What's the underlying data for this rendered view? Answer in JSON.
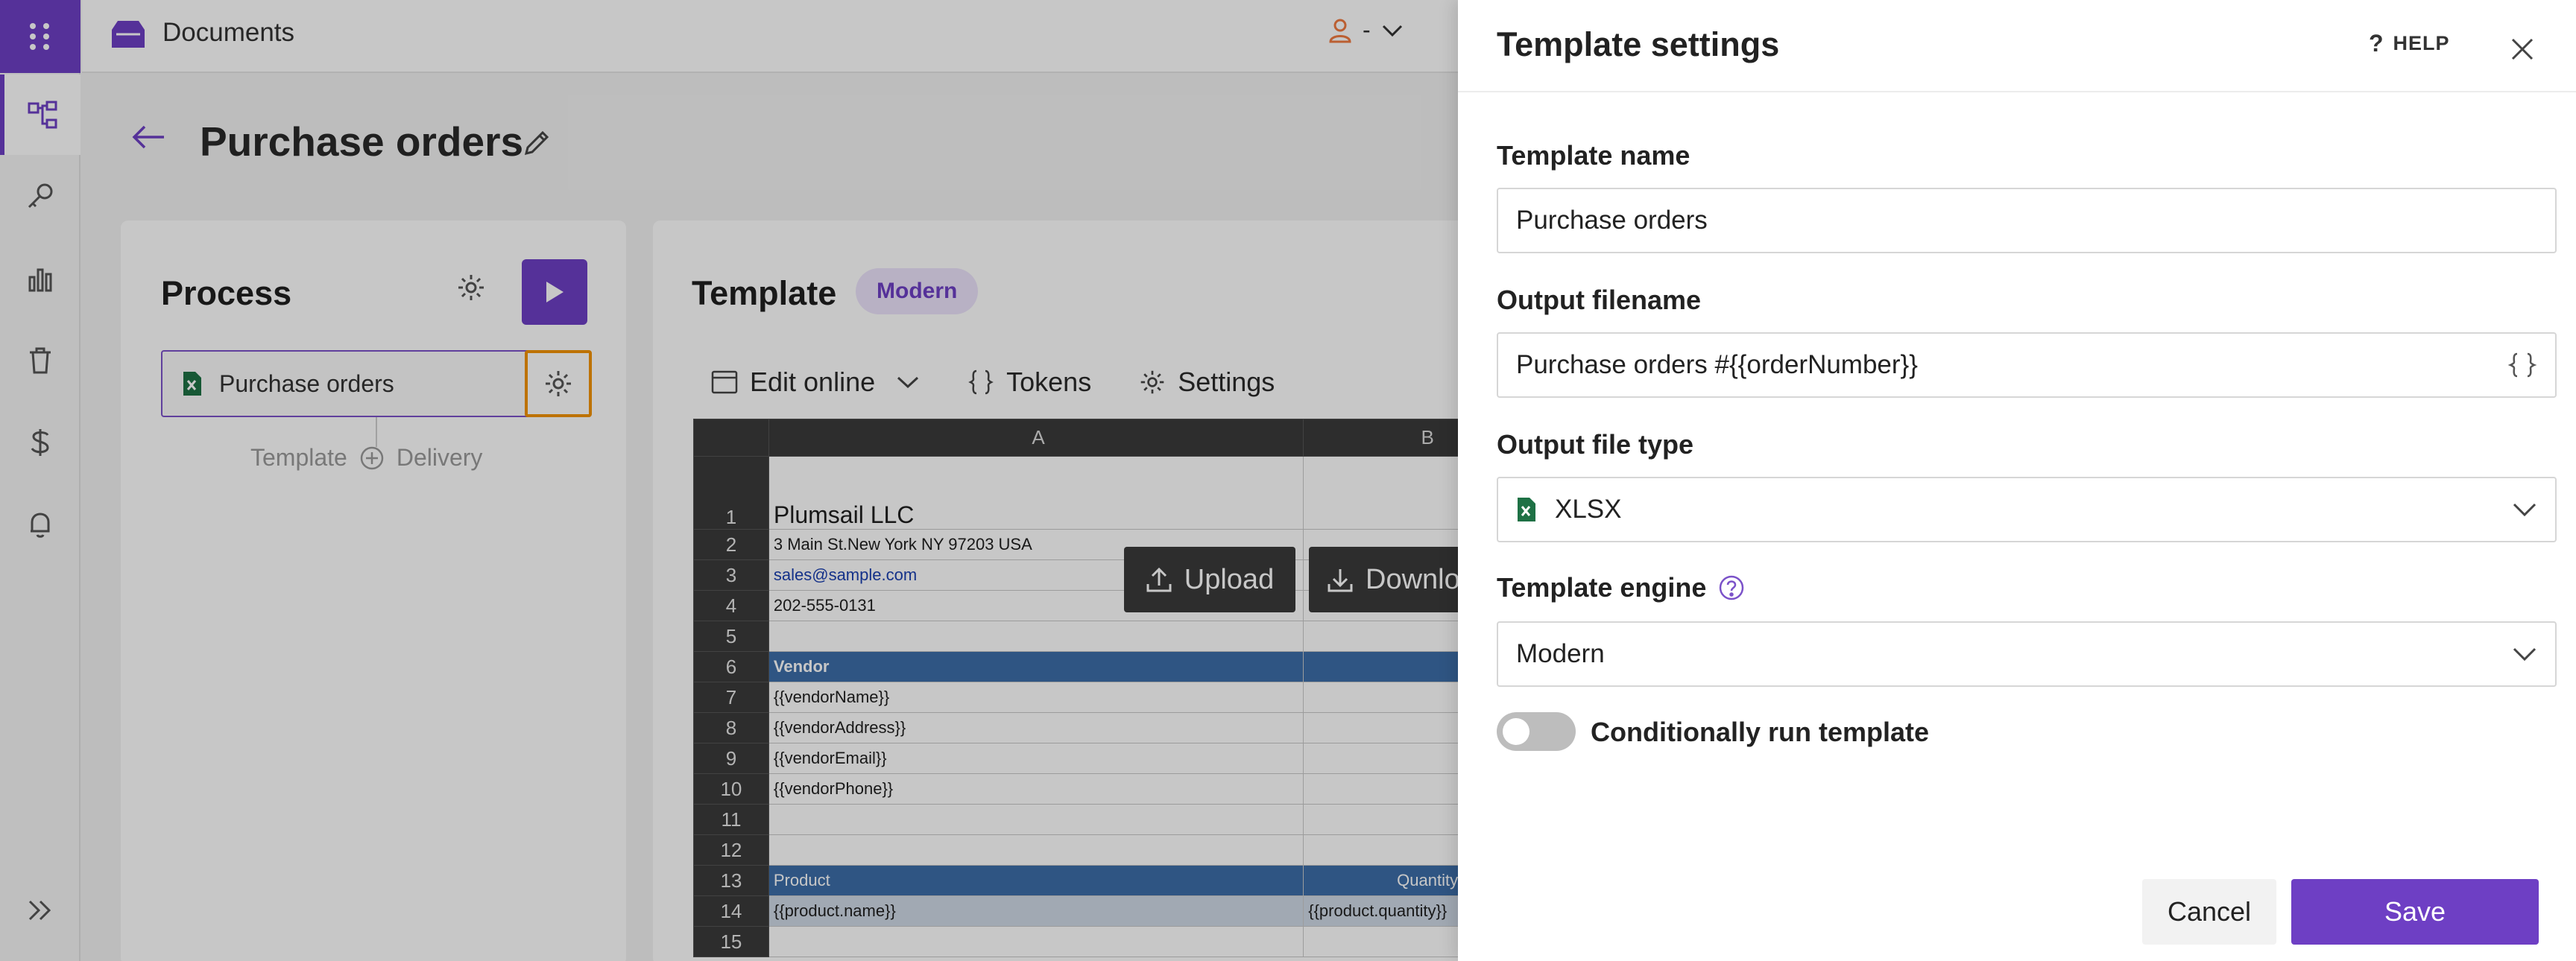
{
  "app": {
    "title": "Documents",
    "user_label": "-"
  },
  "page": {
    "title": "Purchase orders"
  },
  "process": {
    "title": "Process",
    "step_label": "Purchase orders",
    "flow_left": "Template",
    "flow_right": "Delivery"
  },
  "template": {
    "title": "Template",
    "engine_badge": "Modern",
    "toolbar": {
      "edit_online": "Edit online",
      "tokens": "Tokens",
      "settings": "Settings"
    },
    "upload_label": "Upload",
    "download_label": "Download"
  },
  "sheet": {
    "columns": [
      "A",
      "B"
    ],
    "rows": {
      "r1": "Plumsail LLC",
      "r2": "3 Main St.New York NY 97203 USA",
      "r3": "sales@sample.com",
      "r4": "202-555-0131",
      "r6": "Vendor",
      "r7": "{{vendorName}}",
      "r8": "{{vendorAddress}}",
      "r9": "{{vendorEmail}}",
      "r10": "{{vendorPhone}}",
      "r13a": "Product",
      "r13b": "Quantity",
      "r14a": "{{product.name}}",
      "r14b": "{{product.quantity}}"
    },
    "row_numbers": [
      "1",
      "2",
      "3",
      "4",
      "5",
      "6",
      "7",
      "8",
      "9",
      "10",
      "11",
      "12",
      "13",
      "14",
      "15"
    ]
  },
  "panel": {
    "title": "Template settings",
    "help_label": "HELP",
    "template_name_label": "Template name",
    "template_name_value": "Purchase orders",
    "output_filename_label": "Output filename",
    "output_filename_value": "Purchase orders #{{orderNumber}}",
    "output_file_type_label": "Output file type",
    "output_file_type_value": "XLSX",
    "template_engine_label": "Template engine",
    "template_engine_value": "Modern",
    "conditional_label": "Conditionally run template",
    "cancel_label": "Cancel",
    "save_label": "Save"
  },
  "colors": {
    "accent": "#6e3fc4",
    "highlight": "#f39200",
    "excel_green": "#1e7145"
  }
}
